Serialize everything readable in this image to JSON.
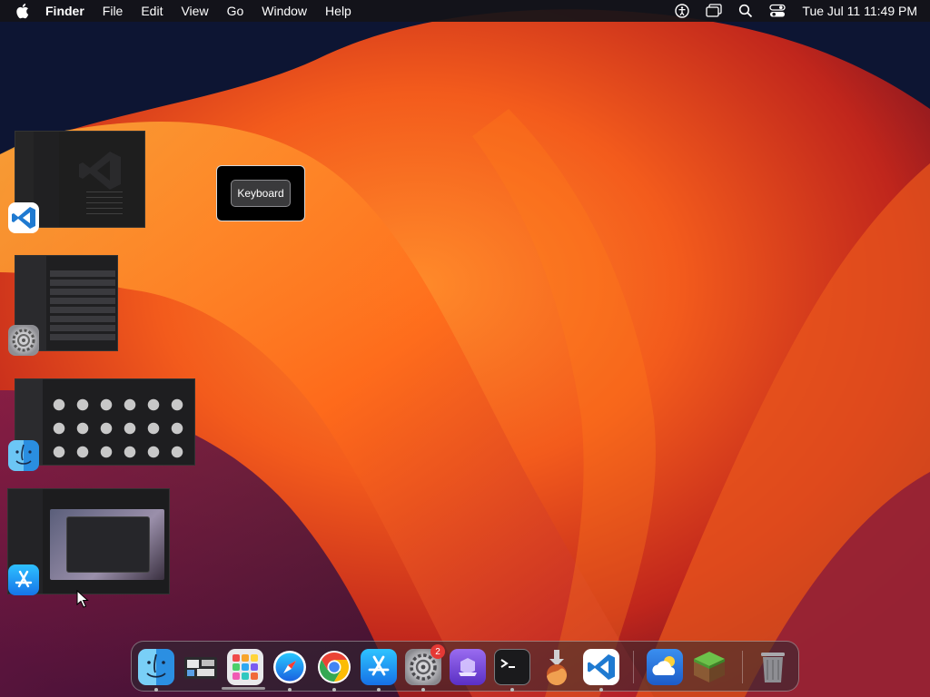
{
  "menubar": {
    "app_name": "Finder",
    "items": [
      "File",
      "Edit",
      "View",
      "Go",
      "Window",
      "Help"
    ],
    "clock": "Tue Jul 11  11:49 PM"
  },
  "tooltip": {
    "label": "Keyboard"
  },
  "thumbnails": [
    {
      "app": "Visual Studio Code",
      "icon": "vscode-icon"
    },
    {
      "app": "System Settings",
      "icon": "system-settings-icon"
    },
    {
      "app": "Finder",
      "icon": "finder-icon"
    },
    {
      "app": "App Store",
      "icon": "app-store-icon"
    }
  ],
  "dock": {
    "apps": [
      {
        "name": "Finder",
        "icon": "finder-icon",
        "running": true
      },
      {
        "name": "Mission Control",
        "icon": "mission-control-icon",
        "running": false
      },
      {
        "name": "Launchpad",
        "icon": "launchpad-icon",
        "running": false
      },
      {
        "name": "Safari",
        "icon": "safari-icon",
        "running": true
      },
      {
        "name": "Chrome",
        "icon": "chrome-icon",
        "running": true
      },
      {
        "name": "App Store",
        "icon": "app-store-icon",
        "running": true
      },
      {
        "name": "System Settings",
        "icon": "system-settings-icon",
        "running": true,
        "badge": "2"
      },
      {
        "name": "Podcasts",
        "icon": "purple-app-icon",
        "running": false
      },
      {
        "name": "Terminal",
        "icon": "terminal-icon",
        "running": true
      },
      {
        "name": "macOS Installer",
        "icon": "installer-icon",
        "running": false
      },
      {
        "name": "Visual Studio Code",
        "icon": "vscode-icon",
        "running": true
      },
      {
        "name": "Weather",
        "icon": "weather-icon",
        "running": false
      },
      {
        "name": "Minecraft",
        "icon": "minecraft-icon",
        "running": false
      },
      {
        "name": "Trash",
        "icon": "trash-icon",
        "running": false
      }
    ]
  },
  "colors": {
    "wallpaper_orange": "#ff7a1a",
    "wallpaper_deep": "#c2201a",
    "wallpaper_navy": "#0d1533",
    "badge_red": "#e53935"
  }
}
